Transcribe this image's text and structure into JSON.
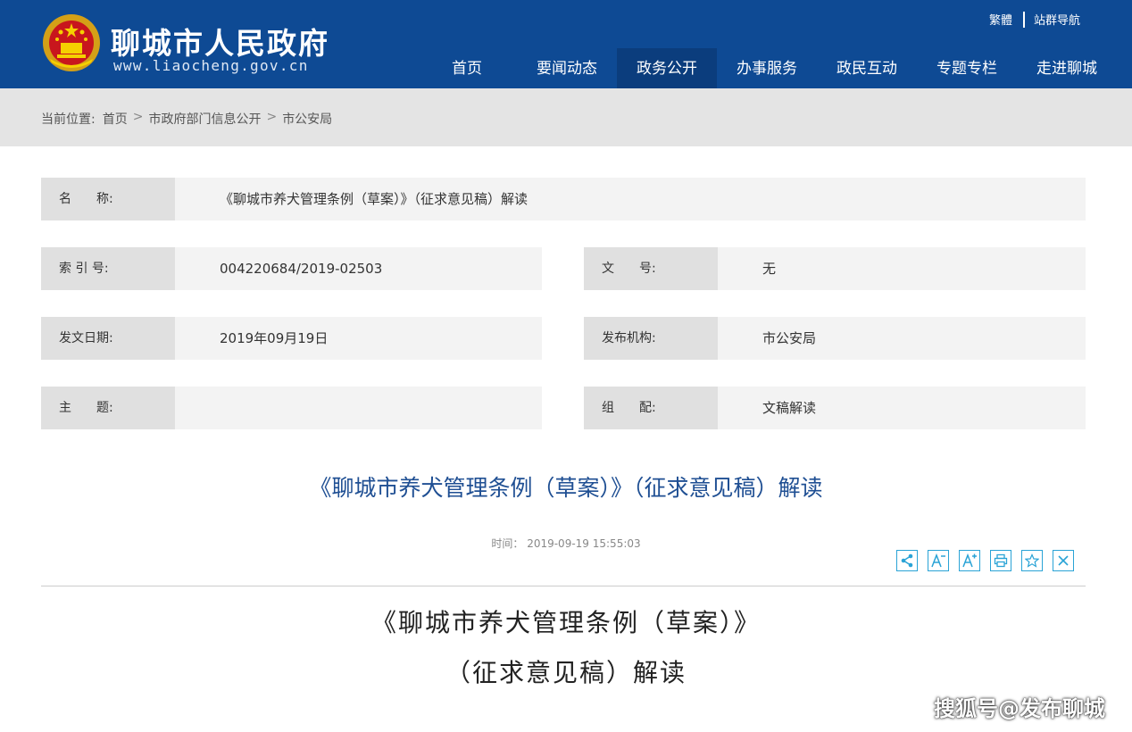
{
  "header": {
    "site_name": "聊城市人民政府",
    "site_url": "www.liaocheng.gov.cn",
    "top_links": [
      "繁體",
      "站群导航"
    ],
    "nav": [
      "首页",
      "要闻动态",
      "政务公开",
      "办事服务",
      "政民互动",
      "专题专栏",
      "走进聊城"
    ],
    "active_nav": "政务公开"
  },
  "breadcrumb": {
    "label": "当前位置:",
    "items": [
      "首页",
      "市政府部门信息公开",
      "市公安局"
    ],
    "separator": ">"
  },
  "info": {
    "name": {
      "label": "名　　称:",
      "value": "《聊城市养犬管理条例（草案）》（征求意见稿）解读"
    },
    "index_no": {
      "label": "索 引 号:",
      "value": "004220684/2019-02503"
    },
    "doc_no": {
      "label": "文　　号:",
      "value": "无"
    },
    "date": {
      "label": "发文日期:",
      "value": "2019年09月19日"
    },
    "org": {
      "label": "发布机构:",
      "value": "市公安局"
    },
    "subject": {
      "label": "主　　题:",
      "value": ""
    },
    "category": {
      "label": "组　　配:",
      "value": "文稿解读"
    }
  },
  "article": {
    "title": "《聊城市养犬管理条例（草案）》（征求意见稿）解读",
    "time_label": "时间：",
    "time": "2019-09-19 15:55:03",
    "tools": [
      "share-icon",
      "font-decrease-icon",
      "font-increase-icon",
      "print-icon",
      "favorite-icon",
      "close-icon"
    ],
    "body_title_line1": "《聊城市养犬管理条例（草案）》",
    "body_title_line2": "（征求意见稿）解读"
  },
  "watermark": "搜狐号@发布聊城",
  "colors": {
    "header_bg": "#0e4a94",
    "title_blue": "#1f4f93",
    "tool_blue": "#2aa3d6"
  }
}
